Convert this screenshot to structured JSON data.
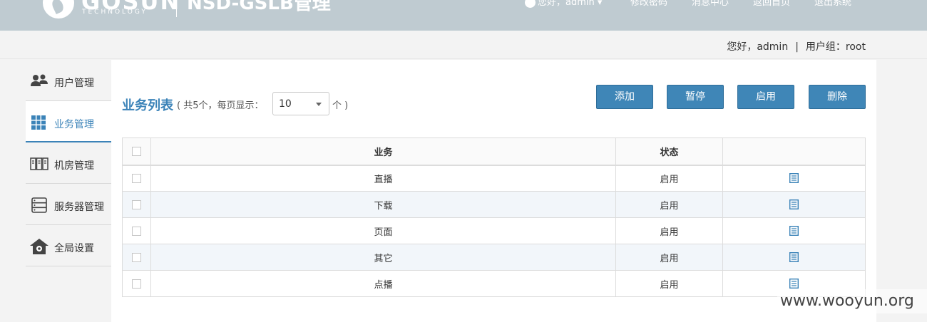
{
  "header": {
    "brand": "GOSUN",
    "brand_sub": "TECHNOLOGY",
    "system_title": "NSD-GSLB管理",
    "user_menu": "您好，admin",
    "nav": [
      "修改密码",
      "消息中心",
      "返回首页",
      "退出系统"
    ]
  },
  "subheader": {
    "greeting": "您好，admin",
    "separator": "|",
    "group": "用户组：root"
  },
  "sidebar": {
    "items": [
      {
        "label": "用户管理",
        "icon": "users-icon"
      },
      {
        "label": "业务管理",
        "icon": "grid-icon",
        "active": true
      },
      {
        "label": "机房管理",
        "icon": "server-rack-icon"
      },
      {
        "label": "服务器管理",
        "icon": "server-list-icon"
      },
      {
        "label": "全局设置",
        "icon": "home-gear-icon"
      }
    ]
  },
  "main": {
    "title": "业务列表",
    "meta_prefix": "( 共5个，每页显示：",
    "per_page": "10",
    "unit": "个 )",
    "buttons": {
      "add": "添加",
      "pause": "暂停",
      "enable": "启用",
      "delete": "删除"
    },
    "table": {
      "headers": [
        "业务",
        "状态",
        ""
      ],
      "rows": [
        {
          "name": "直播",
          "status": "启用"
        },
        {
          "name": "下载",
          "status": "启用"
        },
        {
          "name": "页面",
          "status": "启用"
        },
        {
          "name": "其它",
          "status": "启用"
        },
        {
          "name": "点播",
          "status": "启用"
        }
      ]
    }
  },
  "watermark": "www.wooyun.org",
  "colors": {
    "accent": "#3b83b8",
    "button": "#3f86b7",
    "header_bg": "#bfcbd1",
    "row_alt": "#f2f6fa"
  }
}
